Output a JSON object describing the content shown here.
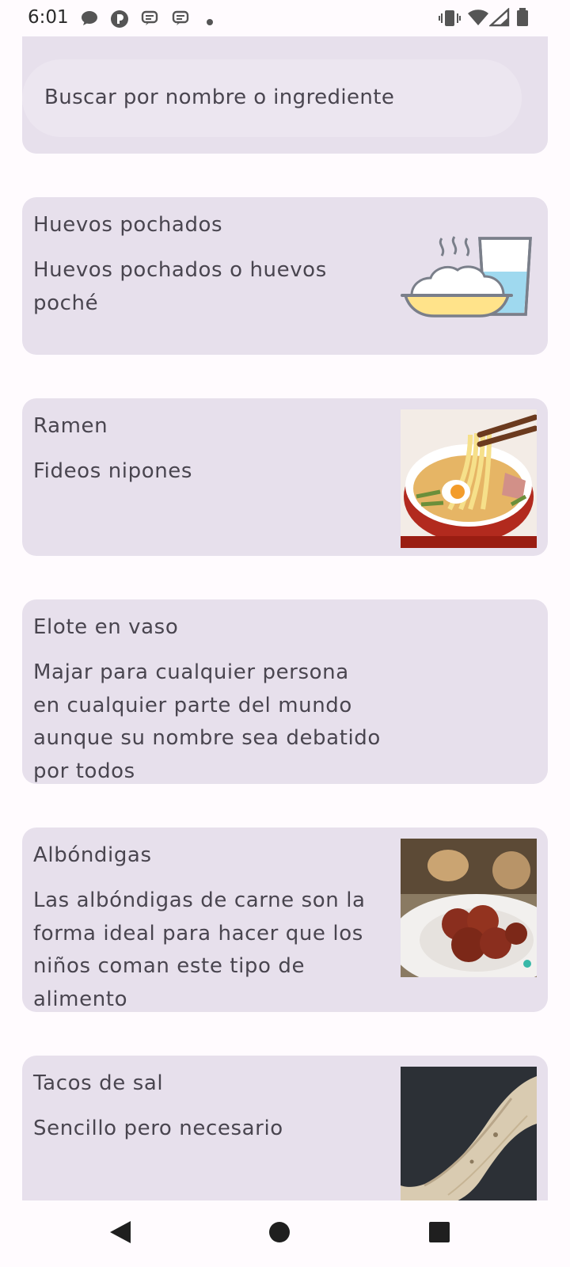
{
  "status_bar": {
    "time": "6:01",
    "icons_left": [
      "chat-bubble-icon",
      "pocket-casts-icon",
      "message-icon",
      "message-icon",
      "dot-icon"
    ],
    "icons_right": [
      "vibrate-icon",
      "wifi-icon",
      "signal-icon",
      "battery-icon"
    ]
  },
  "search": {
    "placeholder": "Buscar por nombre o ingrediente"
  },
  "recipes": [
    {
      "title": "Huevos pochados",
      "description": "Huevos pochados o huevos poché",
      "image": "rice-and-water-illustration"
    },
    {
      "title": "Ramen",
      "description": "Fideos nipones",
      "image": "ramen-photo"
    },
    {
      "title": "Elote en vaso",
      "description": "Majar para cualquier persona en cualquier parte del mundo aunque su nombre sea debatido por todos",
      "image": ""
    },
    {
      "title": "Albóndigas",
      "description": "Las albóndigas de carne son la forma ideal para hacer que los niños coman este tipo de alimento",
      "image": "meatballs-photo"
    },
    {
      "title": "Tacos de sal",
      "description": "Sencillo pero necesario",
      "image": "taco-photo"
    }
  ],
  "nav_bar": {
    "buttons": [
      "back-icon",
      "home-icon",
      "recents-icon"
    ]
  },
  "colors": {
    "background": "#fffbfe",
    "card": "#e7e0ec",
    "search": "#ece6f0",
    "text": "#49454f"
  }
}
